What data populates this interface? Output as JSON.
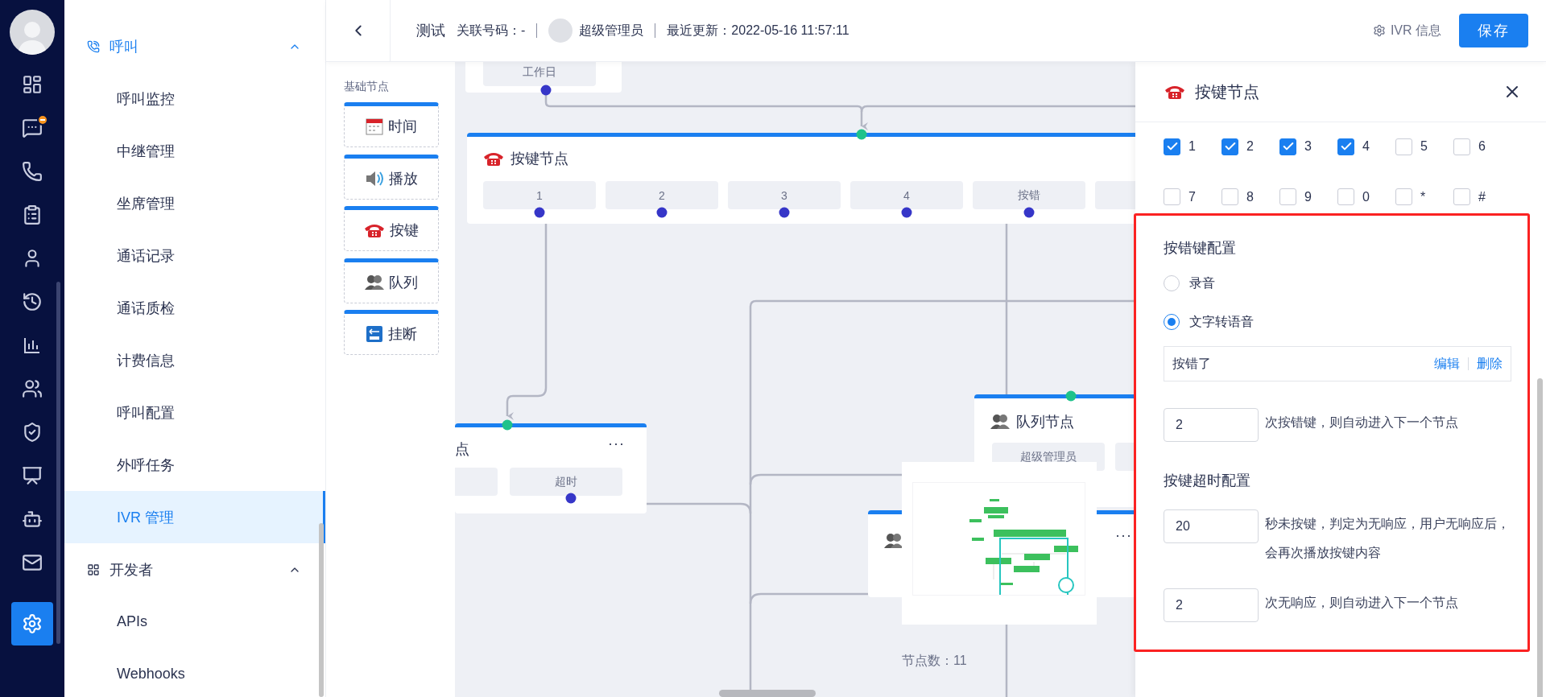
{
  "rail": {
    "items": [
      {
        "selected": false,
        "badge": false
      },
      {
        "selected": false,
        "badge": true
      },
      {
        "selected": false,
        "badge": false
      },
      {
        "selected": false,
        "badge": false
      },
      {
        "selected": false,
        "badge": false
      },
      {
        "selected": false,
        "badge": false
      },
      {
        "selected": false,
        "badge": false
      },
      {
        "selected": false,
        "badge": false
      },
      {
        "selected": false,
        "badge": false
      },
      {
        "selected": false,
        "badge": false
      },
      {
        "selected": false,
        "badge": false
      },
      {
        "selected": false,
        "badge": false
      },
      {
        "selected": true,
        "badge": false
      }
    ]
  },
  "menu": [
    {
      "label": "呼叫",
      "active": true,
      "expanded": true,
      "children": [
        {
          "label": "呼叫监控",
          "selected": false
        },
        {
          "label": "中继管理",
          "selected": false
        },
        {
          "label": "坐席管理",
          "selected": false
        },
        {
          "label": "通话记录",
          "selected": false
        },
        {
          "label": "通话质检",
          "selected": false
        },
        {
          "label": "计费信息",
          "selected": false
        },
        {
          "label": "呼叫配置",
          "selected": false
        },
        {
          "label": "外呼任务",
          "selected": false
        },
        {
          "label": "IVR 管理",
          "selected": true
        }
      ]
    },
    {
      "label": "开发者",
      "active": false,
      "expanded": true,
      "children": [
        {
          "label": "APIs",
          "selected": false
        },
        {
          "label": "Webhooks",
          "selected": false
        }
      ]
    }
  ],
  "header": {
    "title": "测试",
    "linked_number": "关联号码：-",
    "user": "超级管理员",
    "updated": "最近更新：2022-05-16 11:57:11",
    "info": "IVR 信息",
    "save": "保存"
  },
  "palette": {
    "title": "基础节点",
    "items": [
      {
        "label": "时间"
      },
      {
        "label": "播放"
      },
      {
        "label": "按键"
      },
      {
        "label": "队列"
      },
      {
        "label": "挂断"
      }
    ]
  },
  "canvas": {
    "nodes": [
      {
        "kind": "top",
        "chips": [
          {
            "label": "工作日"
          }
        ]
      },
      {
        "kind": "keypress",
        "title": "按键节点",
        "chips": [
          {
            "label": "1"
          },
          {
            "label": "2"
          },
          {
            "label": "3"
          },
          {
            "label": "4"
          },
          {
            "label": "按错"
          }
        ]
      },
      {
        "kind": "left",
        "title": "点",
        "menu": "···",
        "chips": [
          {
            "label": "超时"
          }
        ]
      },
      {
        "kind": "queue",
        "title": "队列节点",
        "chips": [
          {
            "label": "超级管理员"
          }
        ]
      },
      {
        "kind": "covered",
        "menu": "···"
      }
    ],
    "node_count": "节点数：11"
  },
  "panel": {
    "title": "按键节点",
    "keys": [
      {
        "label": "1",
        "checked": true
      },
      {
        "label": "2",
        "checked": true
      },
      {
        "label": "3",
        "checked": true
      },
      {
        "label": "4",
        "checked": true
      },
      {
        "label": "5",
        "checked": false
      },
      {
        "label": "6",
        "checked": false
      },
      {
        "label": "7",
        "checked": false
      },
      {
        "label": "8",
        "checked": false
      },
      {
        "label": "9",
        "checked": false
      },
      {
        "label": "0",
        "checked": false
      },
      {
        "label": "*",
        "checked": false
      },
      {
        "label": "#",
        "checked": false
      }
    ],
    "wrong_key": {
      "title": "按错键配置",
      "options": [
        {
          "label": "录音",
          "selected": false
        },
        {
          "label": "文字转语音",
          "selected": true
        }
      ],
      "tts_text": "按错了",
      "edit": "编辑",
      "delete": "删除",
      "count": "2",
      "count_text": "次按错键，则自动进入下一个节点"
    },
    "timeout": {
      "title": "按键超时配置",
      "seconds": "20",
      "seconds_text": "秒未按键，判定为无响应，用户无响应后，会再次播放按键内容",
      "retries": "2",
      "retries_text": "次无响应，则自动进入下一个节点"
    }
  }
}
